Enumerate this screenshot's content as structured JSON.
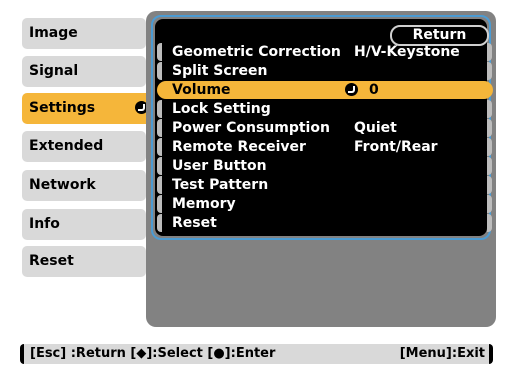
{
  "sidebar": {
    "items": [
      {
        "label": "Image"
      },
      {
        "label": "Signal"
      },
      {
        "label": "Settings"
      },
      {
        "label": "Extended"
      },
      {
        "label": "Network"
      },
      {
        "label": "Info"
      },
      {
        "label": "Reset"
      }
    ],
    "active_index": 2
  },
  "menu": {
    "return_label": "Return",
    "rows": [
      {
        "label": "Geometric Correction",
        "value": "H/V-Keystone"
      },
      {
        "label": "Split Screen",
        "value": ""
      },
      {
        "label": "Volume",
        "value": "0"
      },
      {
        "label": "Lock Setting",
        "value": ""
      },
      {
        "label": "Power Consumption",
        "value": "Quiet"
      },
      {
        "label": "Remote Receiver",
        "value": "Front/Rear"
      },
      {
        "label": "User Button",
        "value": ""
      },
      {
        "label": "Test Pattern",
        "value": ""
      },
      {
        "label": "Memory",
        "value": ""
      },
      {
        "label": "Reset",
        "value": ""
      }
    ],
    "selected_index": 2
  },
  "footer": {
    "left": "[Esc] :Return  [◆]:Select  [●]:Enter",
    "right": "[Menu]:Exit"
  },
  "colors": {
    "accent": "#f5b63a",
    "frame": "#4b9bd3",
    "panel": "#828282",
    "sidebar_bg": "#d9d9d9"
  }
}
